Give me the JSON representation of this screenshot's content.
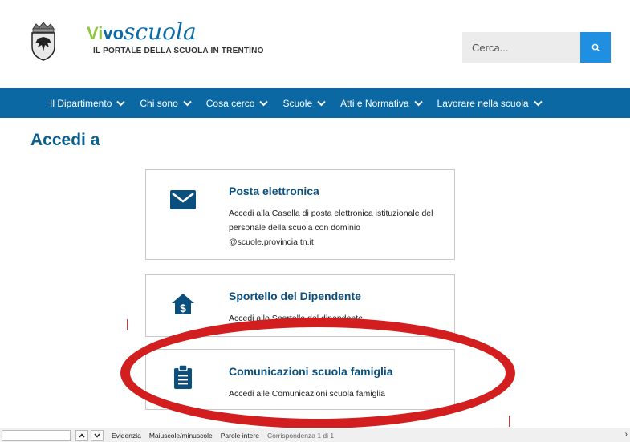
{
  "header": {
    "brand_vi": "Vi",
    "brand_vo": "vo",
    "brand_scuola": "scuola",
    "tagline": "IL PORTALE DELLA SCUOLA IN TRENTINO",
    "crest_icon": "trentino-crest-icon"
  },
  "search": {
    "placeholder": "Cerca...",
    "icon": "search-icon"
  },
  "nav": {
    "items": [
      {
        "label": "Il Dipartimento"
      },
      {
        "label": "Chi sono"
      },
      {
        "label": "Cosa cerco"
      },
      {
        "label": "Scuole"
      },
      {
        "label": "Atti e Normativa"
      },
      {
        "label": "Lavorare nella scuola"
      }
    ]
  },
  "main": {
    "title": "Accedi a",
    "cards": [
      {
        "title": "Posta elettronica",
        "description": "Accedi alla Casella di posta elettronica istituzionale del personale della scuola con dominio @scuole.provincia.tn.it",
        "icon": "envelope-icon"
      },
      {
        "title": "Sportello del Dipendente",
        "description": "Accedi allo Sportello del dipendente",
        "icon": "house-dollar-icon"
      },
      {
        "title": "Comunicazioni scuola famiglia",
        "description": "Accedi alle Comunicazioni scuola famiglia",
        "icon": "clipboard-icon"
      }
    ]
  },
  "findbar": {
    "highlight": "Evidenzia",
    "match_case": "Maiuscole/minuscole",
    "whole_words": "Parole intere",
    "status": "Corrispondenza 1 di 1"
  },
  "colors": {
    "nav_bg": "#0b68a3",
    "accent_blue": "#1e8fe1",
    "title_blue": "#0b5f8f",
    "brand_green": "#8dc63f",
    "annotation_red": "#d21e1e"
  }
}
